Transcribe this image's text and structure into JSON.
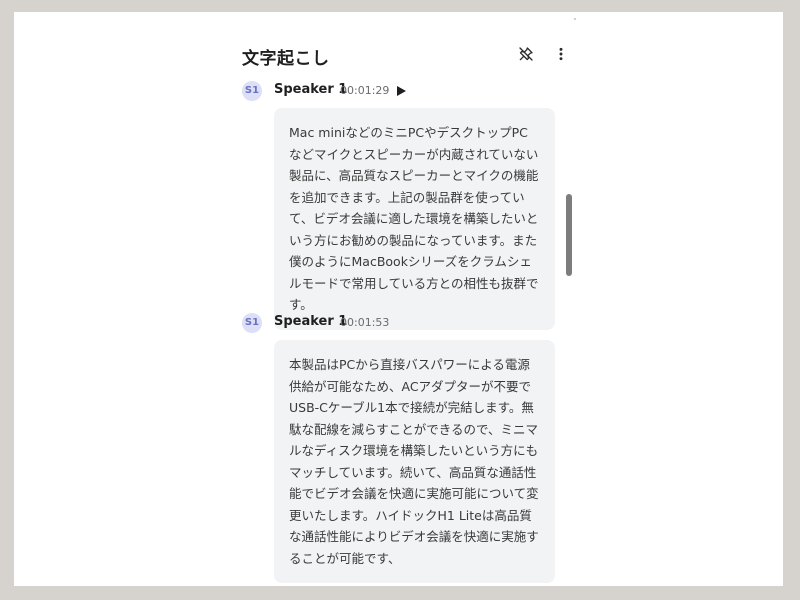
{
  "header": {
    "title": "文字起こし",
    "pin_icon": "pin-off-icon",
    "more_icon": "more-vert-icon"
  },
  "entries": [
    {
      "avatar": "S1",
      "speaker": "Speaker 1",
      "time": "00:01:29",
      "has_play": true,
      "text": "Mac miniなどのミニPCやデスクトップPCなどマイクとスピーカーが内蔵されていない製品に、高品質なスピーカーとマイクの機能を追加できます。上記の製品群を使っていて、ビデオ会議に適した環境を構築したいという方にお勧めの製品になっています。また僕のようにMacBookシリーズをクラムシェルモードで常用している方との相性も抜群です。"
    },
    {
      "avatar": "S1",
      "speaker": "Speaker 1",
      "time": "00:01:53",
      "has_play": false,
      "text": "本製品はPCから直接バスパワーによる電源供給が可能なため、ACアダプターが不要でUSB-Cケーブル1本で接続が完結します。無駄な配線を減らすことができるので、ミニマルなディスク環境を構築したいという方にもマッチしています。続いて、高品質な通話性能でビデオ会議を快適に実施可能について変更いたします。ハイドックH1 Liteは高品質な通話性能によりビデオ会議を快適に実施することが可能です、"
    }
  ],
  "colors": {
    "bubble_bg": "#f1f3f4",
    "avatar_bg": "#dcdff5",
    "avatar_text": "#6a72c4"
  }
}
